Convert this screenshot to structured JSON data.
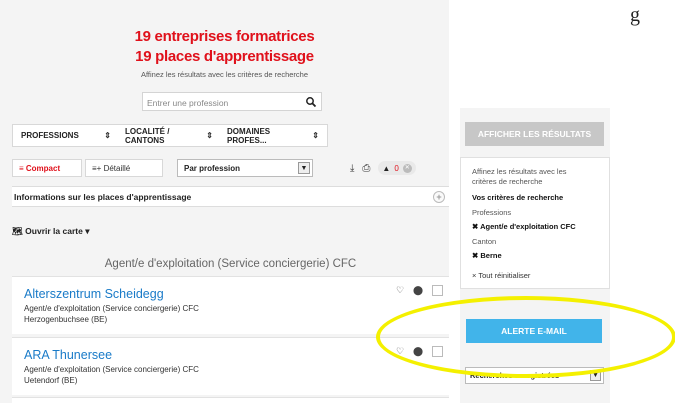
{
  "header": {
    "companies": "19 entreprises formatrices",
    "places": "19 places d'apprentissage",
    "subtitle": "Affinez les résultats avec les critères de recherche"
  },
  "search": {
    "placeholder": "Entrer une profession"
  },
  "filters": [
    {
      "label": "PROFESSIONS"
    },
    {
      "label": "LOCALITÉ / CANTONS"
    },
    {
      "label": "DOMAINES PROFES..."
    }
  ],
  "view": {
    "compact": "≡ Compact",
    "detailed": "≡+ Détaillé",
    "sort": "Par profession",
    "count": "0"
  },
  "info_bar": "Informations sur les places d'apprentissage",
  "map_link": "Ouvrir la carte",
  "group_heading": "Agent/e d'exploitation (Service conciergerie) CFC",
  "results": [
    {
      "name": "Alterszentrum Scheidegg",
      "role": "Agent/e d'exploitation (Service conciergerie) CFC",
      "location": "Herzogenbuchsee (BE)"
    },
    {
      "name": "ARA Thunersee",
      "role": "Agent/e d'exploitation (Service conciergerie) CFC",
      "location": "Uetendorf (BE)"
    }
  ],
  "sidebar": {
    "show_results": "AFFICHER LES RÉSULTATS",
    "refine_text_1": "Affinez les résultats avec les",
    "refine_text_2": "critères de recherche",
    "your_criteria": "Vos critères de recherche",
    "professions_label": "Professions",
    "profession_value": "Agent/e d'exploitation CFC",
    "canton_label": "Canton",
    "canton_value": "Berne",
    "reset": "× Tout réinitialiser",
    "alert_email": "ALERTE E-MAIL",
    "saved_searches": "Recherches enregistrées"
  },
  "colors": {
    "accent_red": "#e0111b",
    "link_blue": "#1a7bc8",
    "alert_blue": "#41b4ea",
    "highlight_yellow": "#f4f000"
  }
}
